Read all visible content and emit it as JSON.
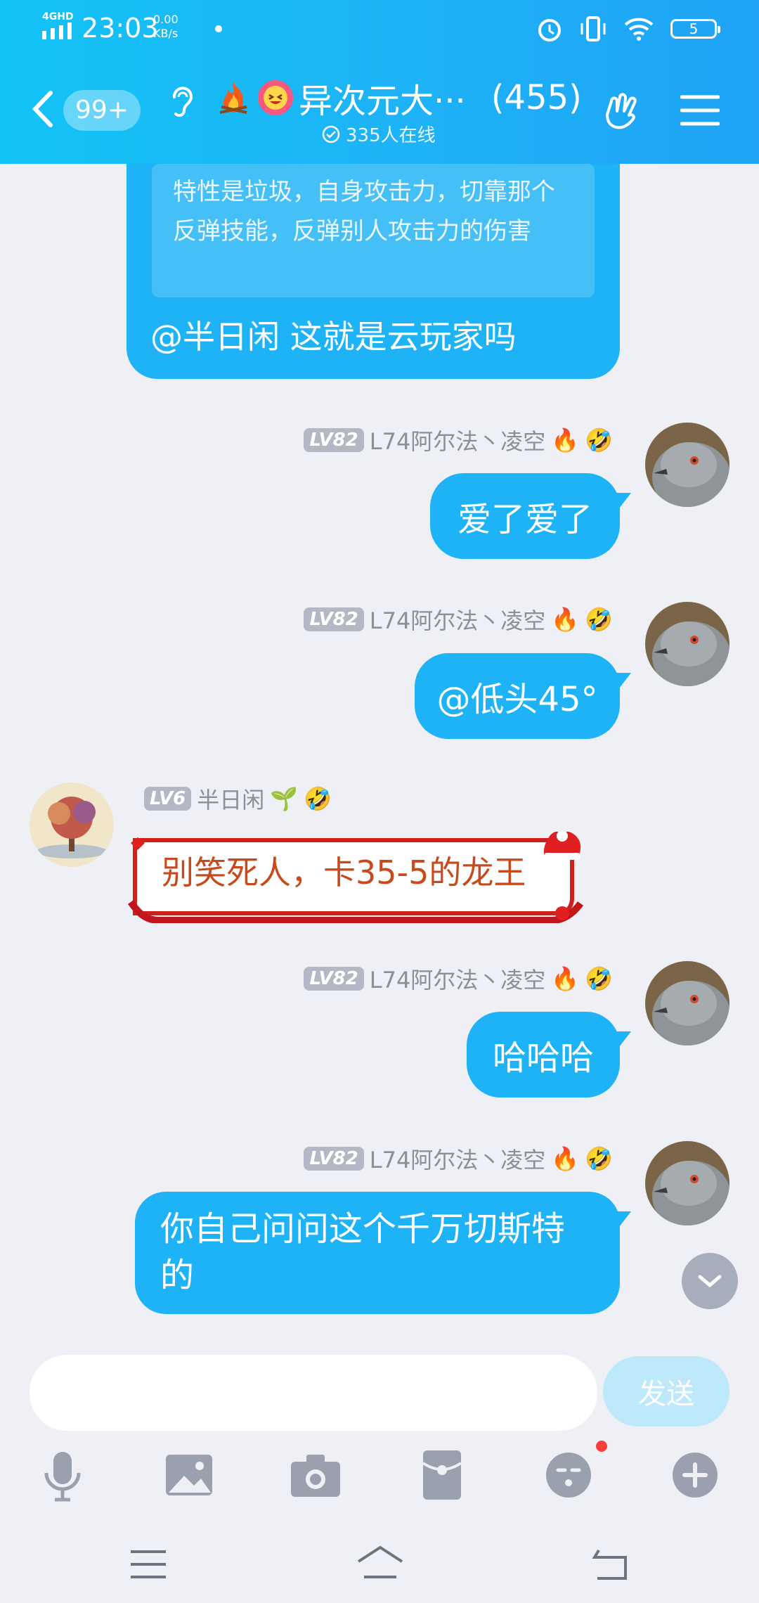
{
  "status_bar": {
    "network": "4GHD",
    "time": "23:03",
    "speed_value": "0.00",
    "speed_unit": "KB/s",
    "battery": "5"
  },
  "header": {
    "unread_badge": "99+",
    "group_name": "异次元大···",
    "member_count": "(455)",
    "online_text": "335人在线"
  },
  "quoted_message": {
    "quote_text": "特性是垃圾，自身攻击力，切靠那个反弹技能，反弹别人攻击力的伤害",
    "reply_text": "@半日闲 这就是云玩家吗"
  },
  "messages": [
    {
      "level": "LV82",
      "sender": "L74阿尔法丶凌空",
      "text": "爱了爱了",
      "side": "right"
    },
    {
      "level": "LV82",
      "sender": "L74阿尔法丶凌空",
      "text": "@低头45°",
      "side": "right"
    },
    {
      "level": "LV6",
      "sender": "半日闲",
      "text": "别笑死人，卡35-5的龙王",
      "side": "left"
    },
    {
      "level": "LV82",
      "sender": "L74阿尔法丶凌空",
      "text": "哈哈哈",
      "side": "right"
    },
    {
      "level": "LV82",
      "sender": "L74阿尔法丶凌空",
      "text": "你自己问问这个千万切斯特的",
      "side": "right"
    }
  ],
  "input": {
    "placeholder": "",
    "send_label": "发送"
  },
  "colors": {
    "header": "#1eb2f6",
    "bubble": "#1db3f6",
    "background": "#eef0f5"
  }
}
